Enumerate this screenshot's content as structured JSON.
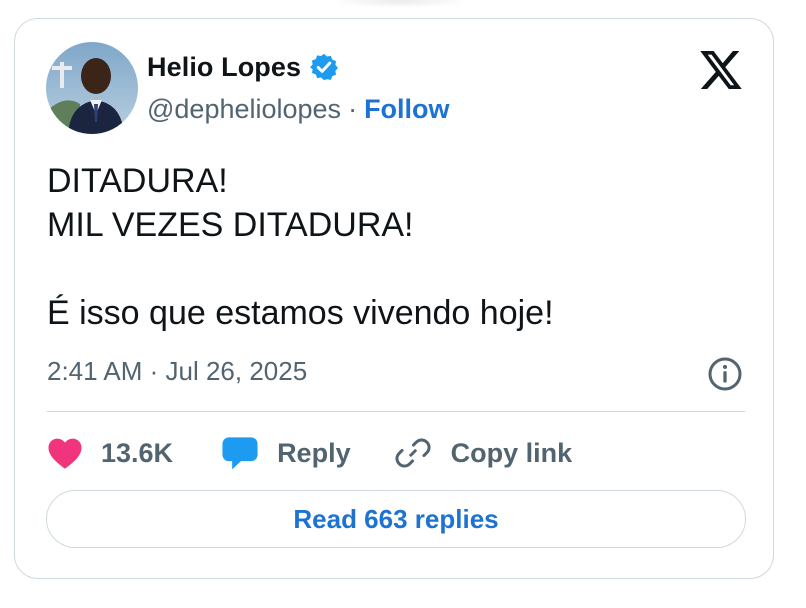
{
  "author": {
    "display_name": "Helio Lopes",
    "handle": "@depheliolopes",
    "verified": true,
    "follow_label": "Follow",
    "separator": "·"
  },
  "tweet": {
    "text": "DITADURA!\nMIL VEZES DITADURA!\n\nÉ isso que estamos vivendo hoje!",
    "timestamp": "2:41 AM · Jul 26, 2025"
  },
  "actions": {
    "like_count": "13.6K",
    "reply_label": "Reply",
    "copy_link_label": "Copy link"
  },
  "read_replies_label": "Read 663 replies",
  "icons": {
    "logo": "x-logo-icon",
    "verified": "verified-badge-icon",
    "info": "info-icon",
    "like": "heart-icon",
    "reply": "speech-bubble-icon",
    "copy": "link-icon"
  },
  "colors": {
    "accent": "#1d73d2",
    "like": "#f0357c",
    "reply_icon": "#1d9bf0",
    "secondary_text": "#536471",
    "border": "#cfd9de"
  }
}
